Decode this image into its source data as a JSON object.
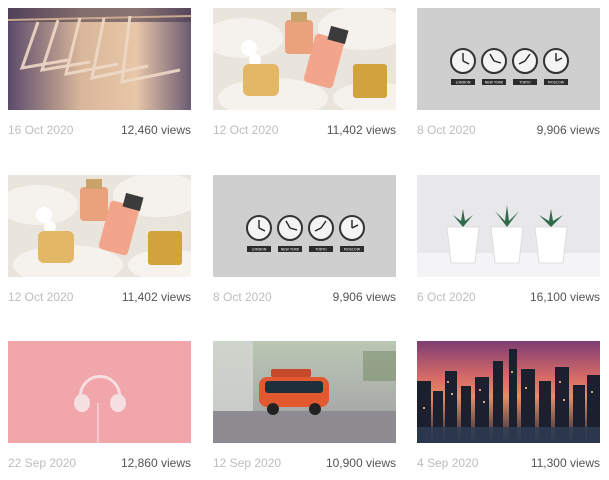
{
  "cards": [
    {
      "date": "16 Oct 2020",
      "views": "12,460 views",
      "image": "wooden-hangers-photo"
    },
    {
      "date": "12 Oct 2020",
      "views": "11,402 views",
      "image": "perfume-bottles-on-fur-photo"
    },
    {
      "date": "8 Oct 2020",
      "views": "9,906 views",
      "image": "world-clocks-photo",
      "clock_labels": [
        "LONDON",
        "NEW YORK",
        "TOKYO",
        "MOSCOW"
      ]
    },
    {
      "date": "12 Oct 2020",
      "views": "11,402 views",
      "image": "perfume-bottles-on-fur-photo"
    },
    {
      "date": "8 Oct 2020",
      "views": "9,906 views",
      "image": "world-clocks-photo",
      "clock_labels": [
        "LONDON",
        "NEW YORK",
        "TOKYO",
        "MOSCOW"
      ]
    },
    {
      "date": "6 Oct 2020",
      "views": "16,100 views",
      "image": "potted-succulents-photo"
    },
    {
      "date": "22 Sep 2020",
      "views": "12,860 views",
      "image": "headphones-on-pink-photo"
    },
    {
      "date": "12 Sep 2020",
      "views": "10,900 views",
      "image": "toy-bus-photo"
    },
    {
      "date": "4 Sep 2020",
      "views": "11,300 views",
      "image": "city-skyline-dusk-photo"
    }
  ]
}
